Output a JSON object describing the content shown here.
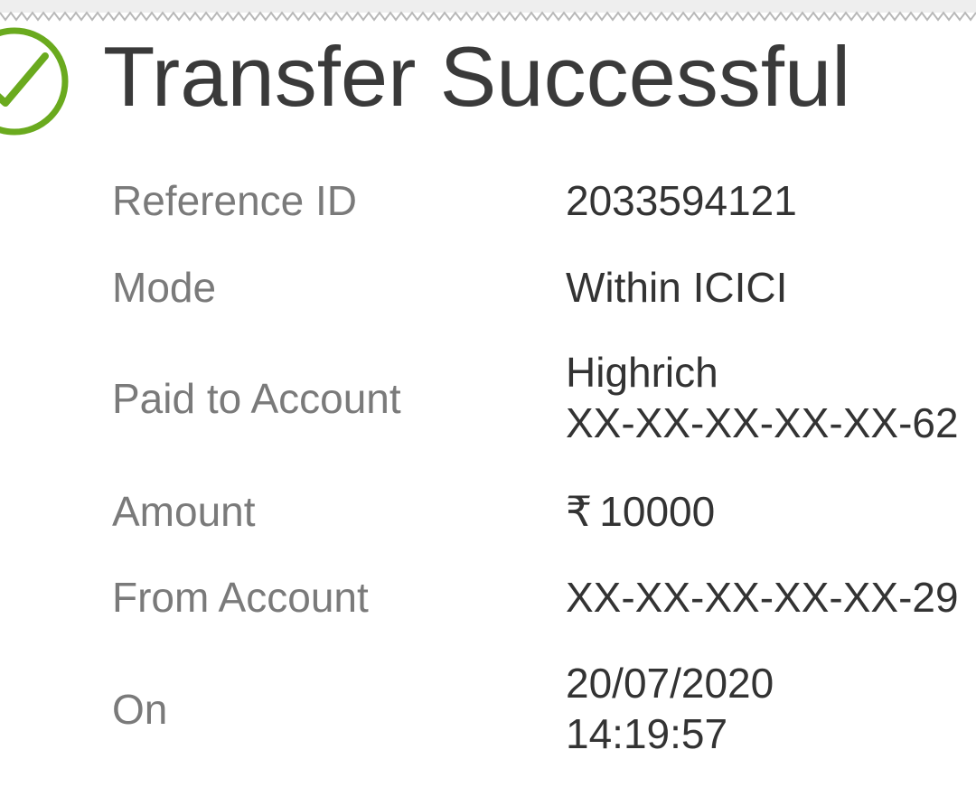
{
  "header": {
    "title": "Transfer Successful",
    "status_icon": "check-circle-icon",
    "accent_color": "#6aaa1e"
  },
  "details": [
    {
      "label": "Reference ID",
      "value": "2033594121"
    },
    {
      "label": "Mode",
      "value": "Within ICICI"
    },
    {
      "label": "Paid to Account",
      "value_lines": [
        "Highrich",
        "XX-XX-XX-XX-XX-62"
      ]
    },
    {
      "label": "Amount",
      "currency_symbol": "₹",
      "value": "10000"
    },
    {
      "label": "From Account",
      "value": "XX-XX-XX-XX-XX-29"
    },
    {
      "label": "On",
      "value_lines": [
        "20/07/2020",
        "14:19:57"
      ]
    }
  ]
}
